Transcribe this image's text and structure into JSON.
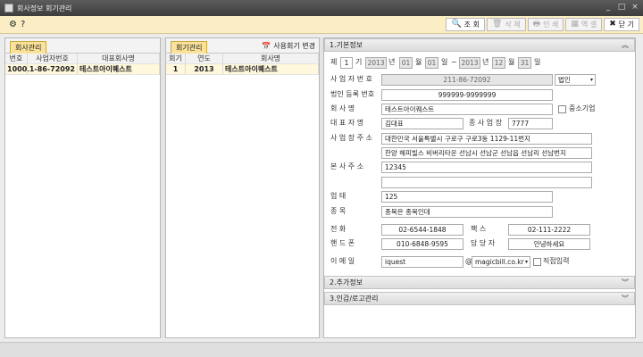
{
  "window": {
    "title": "회사정보 회기관리",
    "buttons": [
      "_",
      "□",
      "×"
    ]
  },
  "toolbar": {
    "buttons": [
      {
        "icon": "search-icon",
        "glyph": "🔍",
        "label": "조 회",
        "disabled": false
      },
      {
        "icon": "trash-icon",
        "glyph": "🗑",
        "label": "삭 제",
        "disabled": true
      },
      {
        "icon": "printer-icon",
        "glyph": "🖶",
        "label": "인 쇄",
        "disabled": true
      },
      {
        "icon": "excel-icon",
        "glyph": "▦",
        "label": "엑 셀",
        "disabled": true
      },
      {
        "icon": "close-circle-icon",
        "glyph": "✖",
        "label": "닫 기",
        "disabled": false
      }
    ]
  },
  "left_panel": {
    "tab": "회사관리",
    "columns": [
      "번호",
      "사업자번호",
      "대표회사명"
    ],
    "rows": [
      [
        "1000",
        "211-86-72092",
        "테스트아이퀘스트"
      ]
    ]
  },
  "mid_panel": {
    "tab": "회기관리",
    "action_label": "사용회기 변경",
    "columns": [
      "회기",
      "연도",
      "회사명"
    ],
    "rows": [
      [
        "1",
        "2013",
        "테스트아이퀘스트"
      ]
    ]
  },
  "basic_info": {
    "section_title": "1.기본정보",
    "period": {
      "prefix": "제",
      "term": "1",
      "term_suffix": "기",
      "from_year": "2013",
      "from_month": "01",
      "from_day": "01",
      "to_year": "2013",
      "to_month": "12",
      "to_day": "31",
      "year_unit": "년",
      "month_unit": "월",
      "day_unit": "일",
      "tilde": "~"
    },
    "biz_no_label": "사 업 자 번 호",
    "biz_no": "211-86-72092",
    "biz_type": "법인",
    "corp_no_label": "법인 등록 번호",
    "corp_no": "999999-9999999",
    "company_label": "회 사 명",
    "company": "테스트아이퀘스트",
    "sme_label": "중소기업",
    "ceo_label": "대 표 자 명",
    "ceo": "김대표",
    "branch_label": "종 사 업 장",
    "branch": "7777",
    "addr_label": "사 업 장 주 소",
    "addr1": "대한민국 서울특별시 구로구 구로3동 1129-11번지",
    "addr2": "한양 해피빌스 비버리타운 선남시 선남군 선남읍 선남리 선남번지",
    "hq_label": "본 사 주 소",
    "hq": "12345",
    "hq2": "",
    "biz_cond_label": "업 태",
    "biz_cond": "125",
    "biz_item_label": "종 목",
    "biz_item": "종목은 종목인데",
    "tel_label": "전 화",
    "tel": "02-6544-1848",
    "fax_label": "팩 스",
    "fax": "02-111-2222",
    "mobile_label": "핸 드 폰",
    "mobile": "010-6848-9595",
    "manager_label": "담 당 자",
    "manager": "안녕하세요",
    "email_label": "이 메 일",
    "email_id": "iquest",
    "at": "@",
    "email_domain": "magicbill.co.kr",
    "direct_label": "직접입력"
  },
  "sections": [
    "2.추가정보",
    "3.인감/로고관리"
  ]
}
